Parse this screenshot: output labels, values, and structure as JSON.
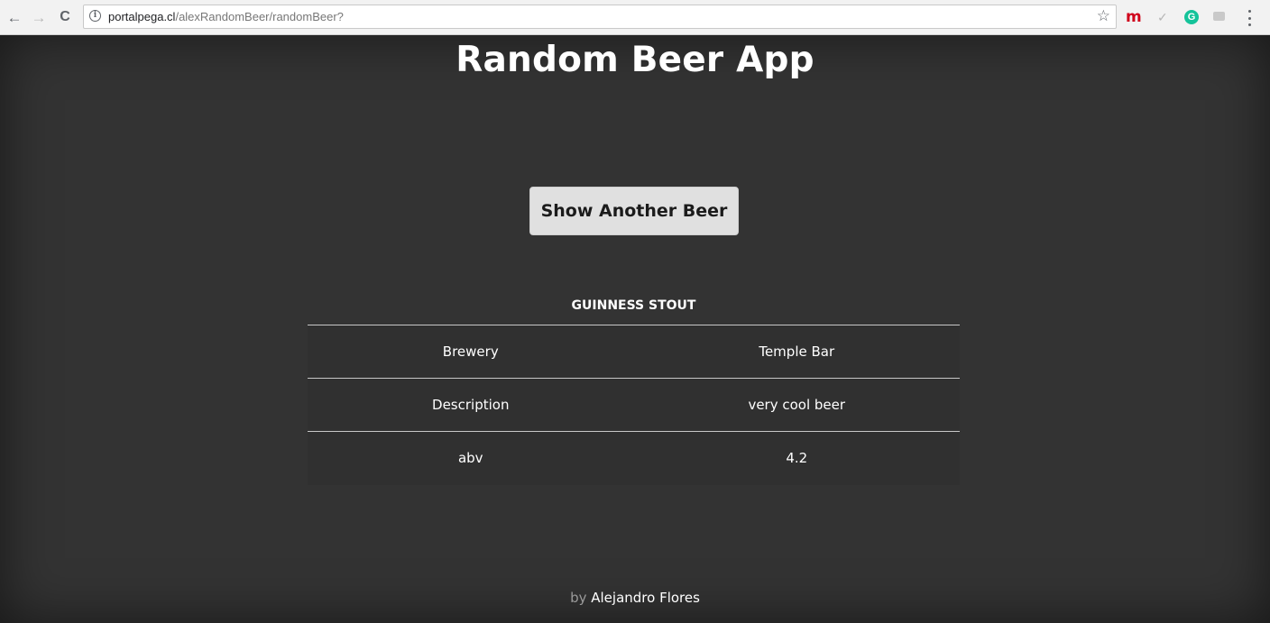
{
  "browser": {
    "url_host": "portalpega.cl",
    "url_path": "/alexRandomBeer/randomBeer?",
    "back_icon": "←",
    "forward_icon": "→",
    "reload_icon": "C",
    "info_icon": "i",
    "star_icon": "☆",
    "ext_m_label": "m",
    "ext_g_label": "G",
    "ext_pen_icon": "✓"
  },
  "page": {
    "title": "Random Beer App",
    "button_label": "Show Another Beer",
    "beer_name": "GUINNESS STOUT",
    "rows": [
      {
        "label": "Brewery",
        "value": "Temple Bar"
      },
      {
        "label": "Description",
        "value": "very cool beer"
      },
      {
        "label": "abv",
        "value": "4.2"
      }
    ],
    "footer_prefix": "by",
    "footer_author": "Alejandro Flores"
  },
  "colors": {
    "page_bg": "#333333",
    "button_bg": "#e0e0e0",
    "grammarly": "#15c39a",
    "ext_m": "#d0021b"
  }
}
